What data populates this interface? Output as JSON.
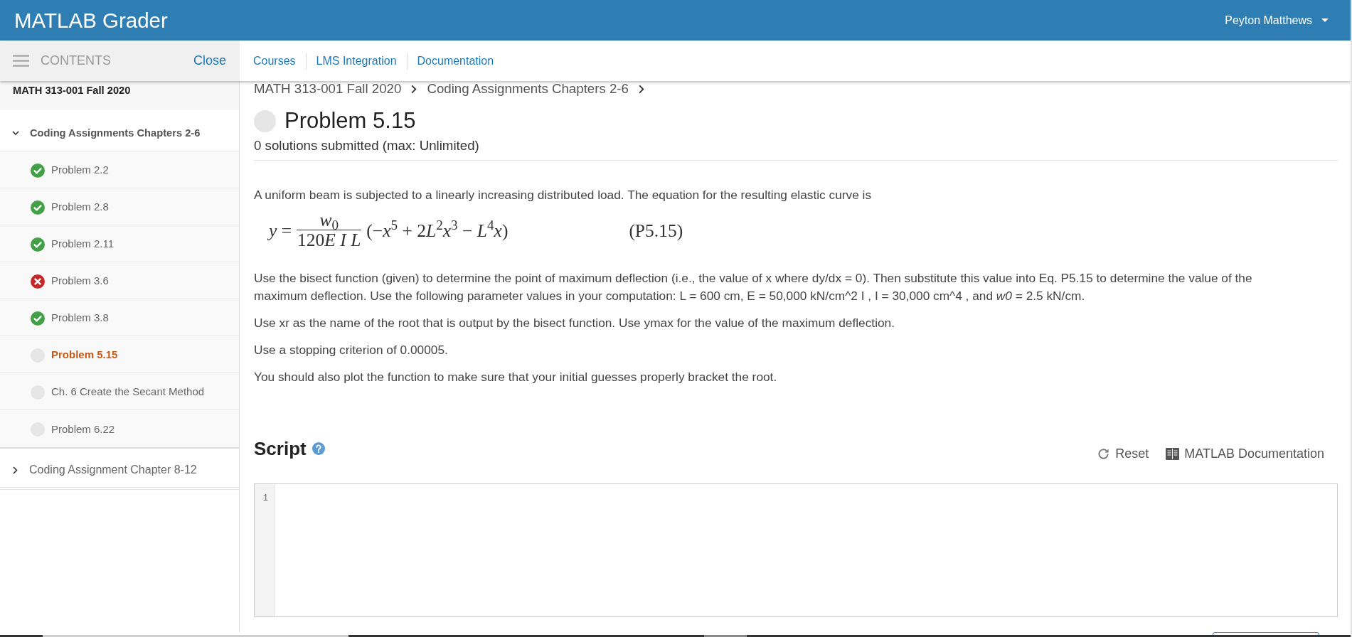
{
  "header": {
    "title": "MATLAB Grader",
    "user": "Peyton Matthews"
  },
  "sidebar": {
    "title": "CONTENTS",
    "close": "Close",
    "course": "MATH 313-001 Fall 2020",
    "sections": [
      {
        "label": "Coding Assignments Chapters 2-6",
        "expanded": true,
        "items": [
          {
            "label": "Problem 2.2",
            "kind": "passed",
            "selected": false
          },
          {
            "label": "Problem 2.8",
            "kind": "passed",
            "selected": false
          },
          {
            "label": "Problem 2.11",
            "kind": "passed",
            "selected": false
          },
          {
            "label": "Problem 3.6",
            "kind": "failed",
            "selected": false
          },
          {
            "label": "Problem 3.8",
            "kind": "passed",
            "selected": false
          },
          {
            "label": "Problem 5.15",
            "kind": "unsubmitted",
            "selected": true
          },
          {
            "label": "Ch. 6 Create the Secant Method",
            "kind": "unsubmitted",
            "selected": false
          },
          {
            "label": "Problem 6.22",
            "kind": "unsubmitted",
            "selected": false
          }
        ]
      },
      {
        "label": "Coding Assignment Chapter 8-12",
        "expanded": false
      }
    ]
  },
  "nav": {
    "links": [
      "Courses",
      "LMS Integration",
      "Documentation"
    ]
  },
  "breadcrumb": [
    "MATH 313-001 Fall 2020",
    "Coding Assignments Chapters 2-6"
  ],
  "problem": {
    "kind": "unsubmitted",
    "title": "Problem 5.15",
    "submissions": "0 solutions submitted (max: Unlimited)"
  },
  "description": {
    "intro": "A uniform beam is subjected to a linearly increasing distributed load. The equation for the resulting elastic curve is",
    "equation": {
      "lhs": "y =",
      "numerator": "w$_{0}$",
      "denominator": "120E I L",
      "expression": "(−x$^{5}$ + 2L$^{2}$x$^{3}$ − L$^{4}$x)",
      "number": "(P5.15)"
    },
    "paragraphs": [
      "Use the bisect function (given) to determine the point of maximum deflection (i.e., the value of x where dy/dx = 0). Then substitute this value into Eq. P5.15 to determine the value of the maximum deflection. Use the following parameter values in your computation: L = 600 cm, E = 50,000 kN/cm^2 I , I = 30,000 cm^4 , and *w0* = 2.5 kN/cm.",
      "Use xr as the name of the root that is output by the bisect function. Use ymax for the value of the maximum deflection.",
      "Use a stopping criterion of 0.00005.",
      "You should also plot the function to make sure that your initial guesses properly bracket the root."
    ]
  },
  "script": {
    "title": "Script",
    "actions": [
      {
        "kind": "reset",
        "label": "Reset"
      },
      {
        "kind": "docs",
        "label": "MATLAB Documentation"
      }
    ],
    "editor": {
      "line_numbers": [
        "1"
      ]
    }
  }
}
